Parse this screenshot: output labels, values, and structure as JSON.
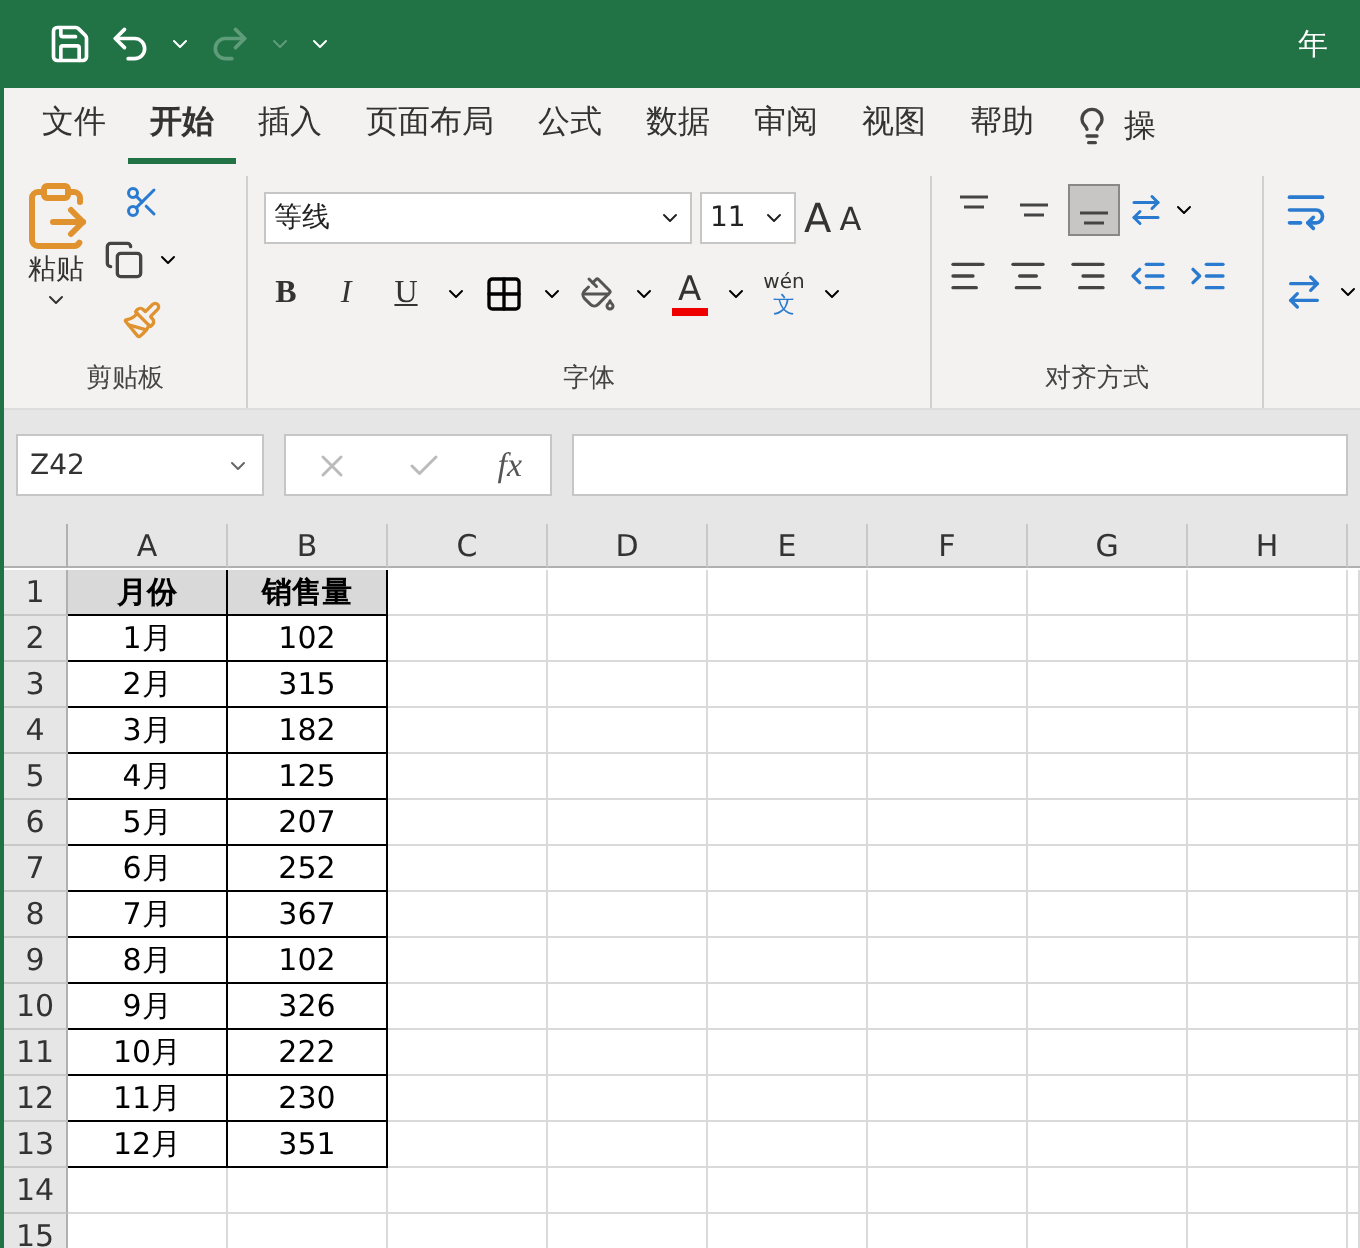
{
  "title_bar": {
    "title": "年",
    "redo_disabled": true
  },
  "tabs": [
    {
      "label": "文件",
      "selected": false
    },
    {
      "label": "开始",
      "selected": true
    },
    {
      "label": "插入",
      "selected": false
    },
    {
      "label": "页面布局",
      "selected": false
    },
    {
      "label": "公式",
      "selected": false
    },
    {
      "label": "数据",
      "selected": false
    },
    {
      "label": "审阅",
      "selected": false
    },
    {
      "label": "视图",
      "selected": false
    },
    {
      "label": "帮助",
      "selected": false
    }
  ],
  "tell_me": "操",
  "ribbon": {
    "clipboard": {
      "paste": "粘贴",
      "label": "剪贴板"
    },
    "font": {
      "name": "等线",
      "size": "11",
      "grow": "A",
      "shrink": "A",
      "bold": "B",
      "italic": "I",
      "underline": "U",
      "font_color": "A",
      "phonetic_top": "wén",
      "phonetic_bottom": "文",
      "label": "字体"
    },
    "alignment": {
      "label": "对齐方式",
      "vertical": [
        {
          "selected": false
        },
        {
          "selected": false
        },
        {
          "selected": true
        }
      ]
    }
  },
  "formula_bar": {
    "name_box": "Z42",
    "fx": "fx"
  },
  "sheet": {
    "columns": [
      "A",
      "B",
      "C",
      "D",
      "E",
      "F",
      "G",
      "H"
    ],
    "header": [
      "月份",
      "销售量"
    ],
    "rows": [
      [
        "1月",
        "102"
      ],
      [
        "2月",
        "315"
      ],
      [
        "3月",
        "182"
      ],
      [
        "4月",
        "125"
      ],
      [
        "5月",
        "207"
      ],
      [
        "6月",
        "252"
      ],
      [
        "7月",
        "367"
      ],
      [
        "8月",
        "102"
      ],
      [
        "9月",
        "326"
      ],
      [
        "10月",
        "222"
      ],
      [
        "11月",
        "230"
      ],
      [
        "12月",
        "351"
      ]
    ],
    "row_numbers": [
      "1",
      "2",
      "3",
      "4",
      "5",
      "6",
      "7",
      "8",
      "9",
      "10",
      "11",
      "12",
      "13",
      "14",
      "15"
    ]
  }
}
